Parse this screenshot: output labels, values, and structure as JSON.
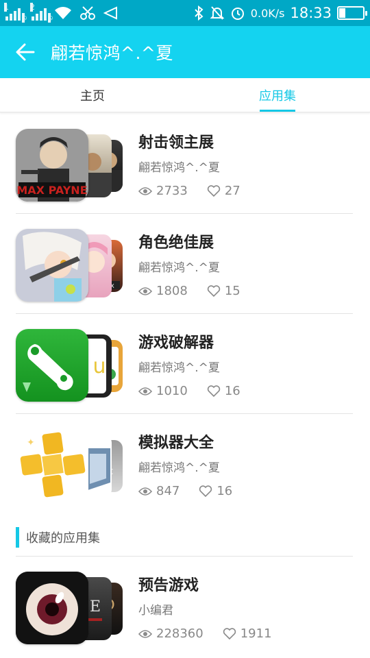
{
  "status_bar": {
    "sim1": "1",
    "sim2": "2",
    "net_speed": "0.0K/s",
    "time": "18:33",
    "battery_fraction": 0.25
  },
  "app_bar": {
    "title": "翩若惊鸿^.^夏"
  },
  "tabs": [
    {
      "label": "主页",
      "active": false
    },
    {
      "label": "应用集",
      "active": true
    }
  ],
  "collections": [
    {
      "name": "射击领主展",
      "author": "翩若惊鸿^.^夏",
      "views": "2733",
      "likes": "27"
    },
    {
      "name": "角色绝佳展",
      "author": "翩若惊鸿^.^夏",
      "views": "1808",
      "likes": "15"
    },
    {
      "name": "游戏破解器",
      "author": "翩若惊鸿^.^夏",
      "views": "1010",
      "likes": "16"
    },
    {
      "name": "模拟器大全",
      "author": "翩若惊鸿^.^夏",
      "views": "847",
      "likes": "16"
    }
  ],
  "favorites_section": {
    "title": "收藏的应用集"
  },
  "favorites": [
    {
      "name": "预告游戏",
      "author": "小编君",
      "views": "228360",
      "likes": "1911"
    }
  ],
  "colors": {
    "status_bar": "#00a8c6",
    "app_bar": "#14d3f0",
    "accent": "#15c8e6"
  }
}
